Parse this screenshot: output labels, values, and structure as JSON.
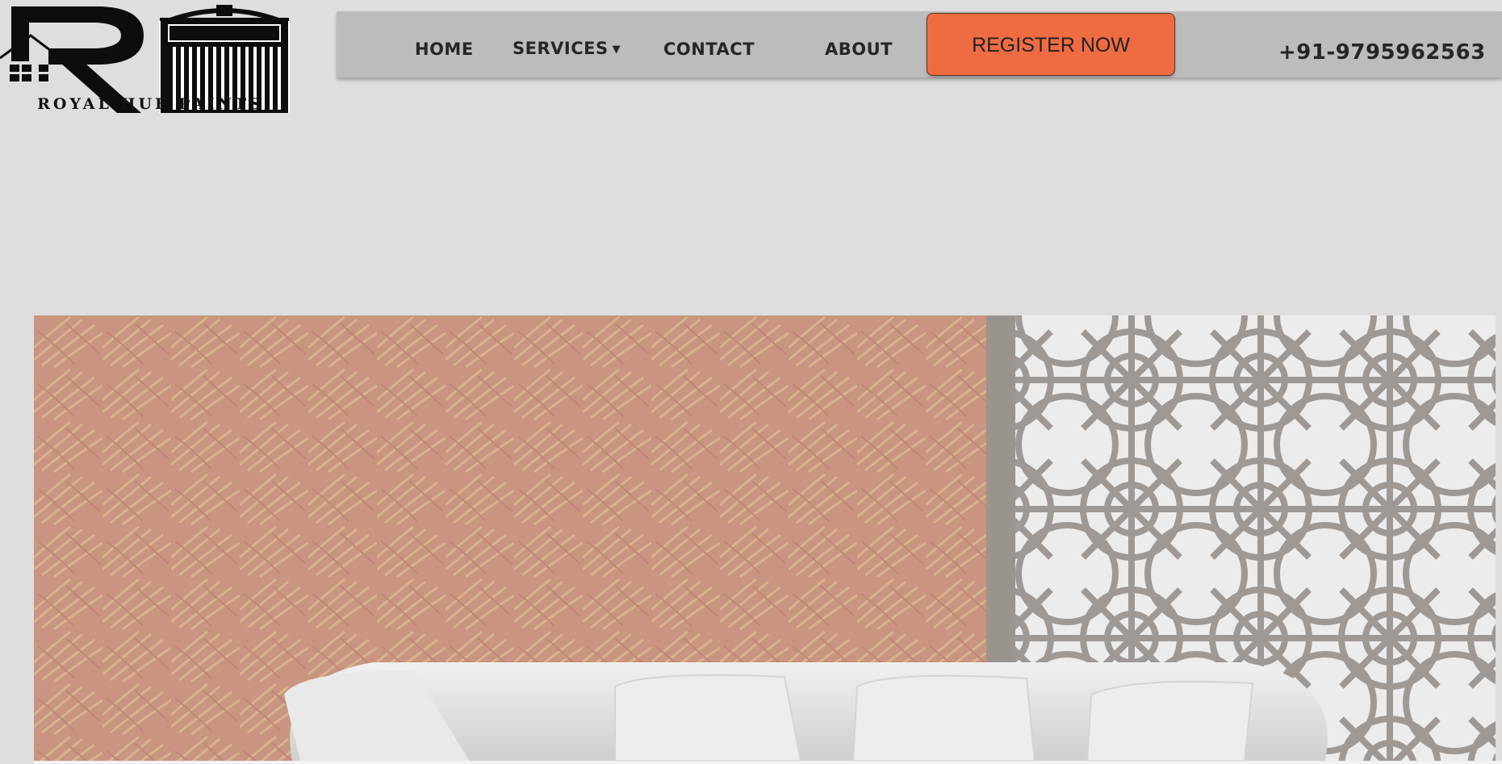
{
  "brand": {
    "name": "ROYAL HUE PAINTS",
    "logo_icon": "house-paint-bucket-logo"
  },
  "nav": {
    "home": "HOME",
    "services": "SERVICES",
    "contact": "CONTACT",
    "about": "ABOUT",
    "register": "REGISTER NOW",
    "phone": "+91-9795962563"
  },
  "colors": {
    "page_bg": "#dedede",
    "navbar_bg": "#bcbcbc",
    "register_bg": "#ef6c43",
    "wall_texture": "#c99581",
    "jali_panel": "#9f9995"
  },
  "hero": {
    "image": "room-interior-with-textured-wall-jali-panel-and-white-sofa"
  }
}
